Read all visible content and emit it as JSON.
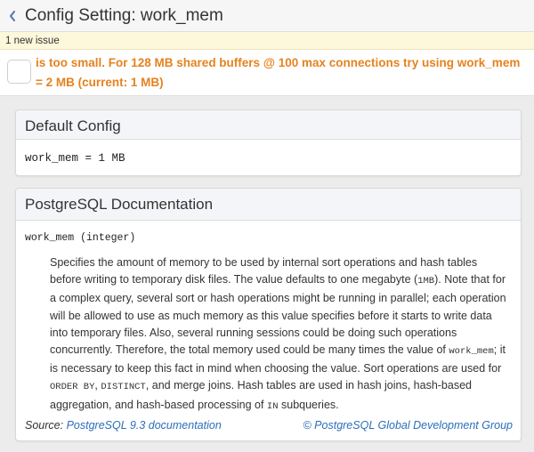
{
  "header": {
    "title": "Config Setting: work_mem"
  },
  "issues": {
    "count_label": "1 new issue",
    "items": [
      {
        "text": "is too small. For 128 MB shared buffers @ 100 max connections try using work_mem = 2 MB (current: 1 MB)"
      }
    ]
  },
  "default_config": {
    "title": "Default Config",
    "value": "work_mem = 1 MB"
  },
  "docs": {
    "title": "PostgreSQL Documentation",
    "signature": "work_mem (integer)",
    "paragraph": [
      {
        "text": "Specifies the amount of memory to be used by internal sort operations and hash tables before writing to temporary disk files. The value defaults to one megabyte ("
      },
      {
        "code": "1MB"
      },
      {
        "text": "). Note that for a complex query, several sort or hash operations might be running in parallel; each operation will be allowed to use as much memory as this value specifies before it starts to write data into temporary files. Also, several running sessions could be doing such operations concurrently. Therefore, the total memory used could be many times the value of "
      },
      {
        "code": "work_mem"
      },
      {
        "text": "; it is necessary to keep this fact in mind when choosing the value. Sort operations are used for "
      },
      {
        "code": "ORDER BY"
      },
      {
        "text": ", "
      },
      {
        "code": "DISTINCT"
      },
      {
        "text": ", and merge joins. Hash tables are used in hash joins, hash-based aggregation, and hash-based processing of "
      },
      {
        "code": "IN"
      },
      {
        "text": " subqueries."
      }
    ],
    "source_label": "Source:",
    "source_link": "PostgreSQL 9.3 documentation",
    "copyright_link": "© PostgreSQL Global Development Group"
  },
  "colors": {
    "issue_text": "#e6821e",
    "link": "#2a6ebb",
    "issue_bar_bg": "#fdf7dc"
  }
}
